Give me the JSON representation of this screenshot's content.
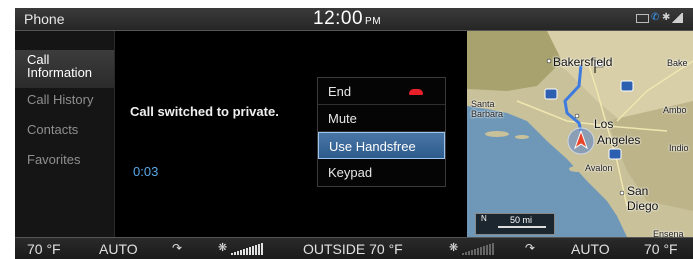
{
  "topbar": {
    "app_title": "Phone",
    "clock": "12:00",
    "ampm": "PM",
    "icons": [
      "battery-icon",
      "phone-connected-icon",
      "bluetooth-icon",
      "signal-icon"
    ]
  },
  "sidebar": {
    "items": [
      {
        "label_line1": "Call",
        "label_line2": "Information",
        "active": true
      },
      {
        "label": "Call History"
      },
      {
        "label": "Contacts"
      },
      {
        "label": "Favorites"
      }
    ]
  },
  "call": {
    "message": "Call switched to private.",
    "timer": "0:03"
  },
  "menu": {
    "items": [
      {
        "label": "End",
        "icon": "hang-up-icon"
      },
      {
        "label": "Mute"
      },
      {
        "label": "Use Handsfree",
        "selected": true
      },
      {
        "label": "Keypad"
      }
    ]
  },
  "map": {
    "labels": {
      "bakersfield": "Bakersfield",
      "bake": "Bake",
      "santa_barbara_1": "Santa",
      "santa_barbara_2": "Barbara",
      "los": "Los",
      "angeles": "Angeles",
      "ambo": "Ambo",
      "indio": "Indio",
      "avalon": "Avalon",
      "san": "San",
      "diego": "Diego",
      "ensena": "Ensena"
    },
    "highways": [
      "5",
      "40",
      "15"
    ],
    "scale": {
      "north": "N",
      "label": "50 mi"
    },
    "route_color": "#3d7be0",
    "vehicle_color": "#e8442a"
  },
  "climate": {
    "left_temp": "70 °F",
    "left_mode": "AUTO",
    "outside": "OUTSIDE  70 °F",
    "right_mode": "AUTO",
    "right_temp": "70 °F"
  }
}
